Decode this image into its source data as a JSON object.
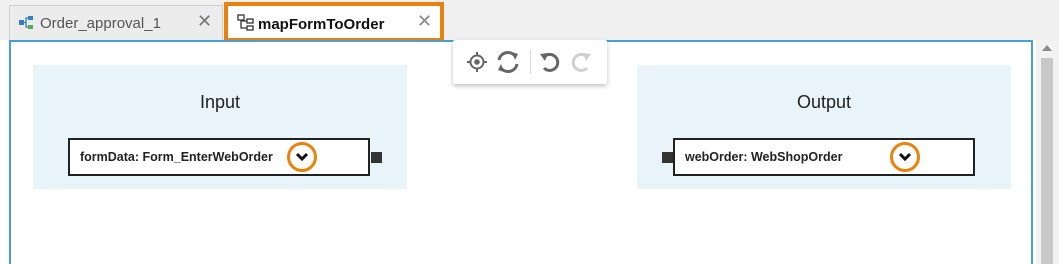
{
  "tabs": [
    {
      "label": "Order_approval_1",
      "active": false,
      "icon": "process-flow-icon"
    },
    {
      "label": "mapFormToOrder",
      "active": true,
      "icon": "mapping-icon"
    }
  ],
  "toolbar": {
    "buttons": [
      "locate-icon",
      "refresh-icon",
      "undo-icon",
      "redo-icon"
    ]
  },
  "input": {
    "title": "Input",
    "field": "formData: Form_EnterWebOrder"
  },
  "output": {
    "title": "Output",
    "field": "webOrder: WebShopOrder"
  },
  "colors": {
    "highlight": "#e8820c",
    "panel": "#e8f3fa",
    "canvas_border": "#4a9fd5"
  }
}
